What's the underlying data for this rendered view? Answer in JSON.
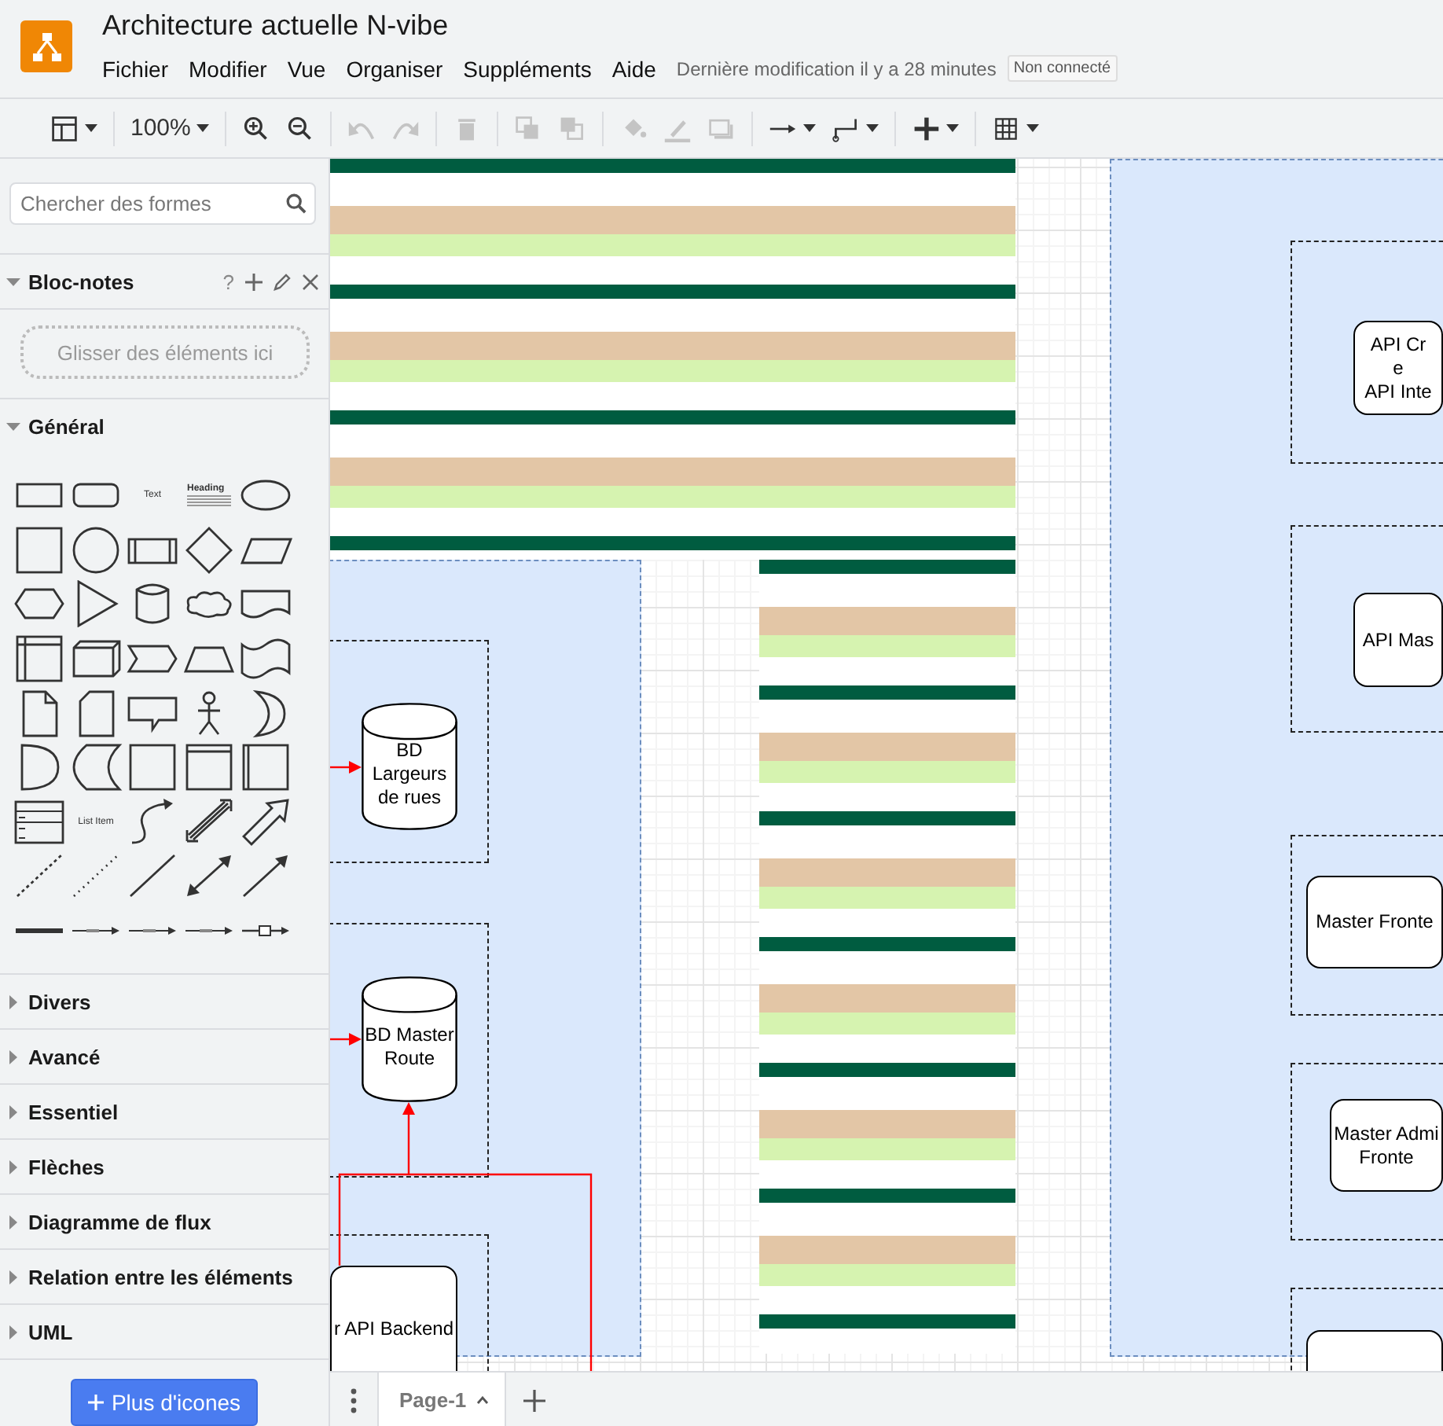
{
  "app": {
    "title": "Architecture actuelle N-vibe",
    "menu": [
      "Fichier",
      "Modifier",
      "Vue",
      "Organiser",
      "Suppléments",
      "Aide"
    ],
    "last_saved": "Dernière modification il y a 28 minutes",
    "status_badge": "Non connecté"
  },
  "toolbar": [
    [
      {
        "kind": "panel",
        "dropdown": true,
        "disabled": false
      }
    ],
    [
      {
        "kind": "zoom",
        "label": "100%",
        "dropdown": true,
        "disabled": false
      }
    ],
    [
      {
        "kind": "zoomin",
        "dropdown": false,
        "disabled": false
      },
      {
        "kind": "zoomout",
        "dropdown": false,
        "disabled": false
      }
    ],
    [
      {
        "kind": "undo",
        "dropdown": false,
        "disabled": true
      },
      {
        "kind": "redo",
        "dropdown": false,
        "disabled": true
      }
    ],
    [
      {
        "kind": "delete",
        "dropdown": false,
        "disabled": true
      }
    ],
    [
      {
        "kind": "tofront",
        "dropdown": false,
        "disabled": true
      },
      {
        "kind": "toback",
        "dropdown": false,
        "disabled": true
      }
    ],
    [
      {
        "kind": "fill",
        "dropdown": false,
        "disabled": true
      },
      {
        "kind": "linecolor",
        "dropdown": false,
        "disabled": true
      },
      {
        "kind": "shadow",
        "dropdown": false,
        "disabled": true
      }
    ],
    [
      {
        "kind": "connection",
        "dropdown": true,
        "disabled": false
      },
      {
        "kind": "waypoints",
        "dropdown": true,
        "disabled": false
      }
    ],
    [
      {
        "kind": "insert",
        "dropdown": true,
        "disabled": false
      }
    ],
    [
      {
        "kind": "table",
        "dropdown": true,
        "disabled": false
      }
    ]
  ],
  "sidebar": {
    "search": {
      "placeholder": "Chercher des formes"
    },
    "scratchpad": {
      "title": "Bloc-notes",
      "expanded": true,
      "help": "?",
      "drop_hint": "Glisser des éléments ici"
    },
    "general": {
      "title": "Général",
      "expanded": true,
      "shapes": [
        {
          "kind": "rect"
        },
        {
          "kind": "rounded"
        },
        {
          "kind": "text",
          "label": "Text"
        },
        {
          "kind": "heading",
          "label": "Heading"
        },
        {
          "kind": "ellipse"
        },
        {
          "kind": "square"
        },
        {
          "kind": "circle"
        },
        {
          "kind": "process"
        },
        {
          "kind": "diamond"
        },
        {
          "kind": "parallelogram"
        },
        {
          "kind": "hexagon"
        },
        {
          "kind": "triangle"
        },
        {
          "kind": "cylinder"
        },
        {
          "kind": "cloud"
        },
        {
          "kind": "document"
        },
        {
          "kind": "storage"
        },
        {
          "kind": "cube"
        },
        {
          "kind": "step"
        },
        {
          "kind": "trapezoid"
        },
        {
          "kind": "tape"
        },
        {
          "kind": "note"
        },
        {
          "kind": "card"
        },
        {
          "kind": "callout"
        },
        {
          "kind": "actor"
        },
        {
          "kind": "crescent"
        },
        {
          "kind": "halfround"
        },
        {
          "kind": "datastore"
        },
        {
          "kind": "square"
        },
        {
          "kind": "container"
        },
        {
          "kind": "swimlane"
        },
        {
          "kind": "list"
        },
        {
          "kind": "text",
          "label": "List Item"
        },
        {
          "kind": "curve"
        },
        {
          "kind": "doublearrow"
        },
        {
          "kind": "blockarrow"
        },
        {
          "kind": "dashed"
        },
        {
          "kind": "dotted"
        },
        {
          "kind": "line"
        },
        {
          "kind": "bidirectional"
        },
        {
          "kind": "directional"
        },
        {
          "kind": "thickline"
        },
        {
          "kind": "labeled"
        },
        {
          "kind": "labeled"
        },
        {
          "kind": "labeled"
        },
        {
          "kind": "boxlink"
        }
      ]
    },
    "sections": [
      {
        "title": "Divers",
        "expanded": false
      },
      {
        "title": "Avancé",
        "expanded": false
      },
      {
        "title": "Essentiel",
        "expanded": false
      },
      {
        "title": "Flèches",
        "expanded": false
      },
      {
        "title": "Diagramme de flux",
        "expanded": false
      },
      {
        "title": "Relation entre les éléments",
        "expanded": false
      },
      {
        "title": "UML",
        "expanded": false
      }
    ],
    "more_button": "Plus d'icones"
  },
  "canvas": {
    "nodes": [
      {
        "kind": "cylinder",
        "lines": [
          "BD",
          "Largeurs",
          "de rues"
        ]
      },
      {
        "kind": "cylinder",
        "lines": [
          "BD Master",
          "Route"
        ]
      },
      {
        "kind": "rounded",
        "lines": [
          "r API Backend"
        ]
      },
      {
        "kind": "rounded",
        "lines": [
          "API Cr",
          "e",
          "API Inte"
        ]
      },
      {
        "kind": "rounded",
        "lines": [
          "API Mas"
        ]
      },
      {
        "kind": "rounded",
        "lines": [
          "Master Fronte"
        ]
      },
      {
        "kind": "rounded",
        "lines": [
          "Master Admi",
          "Fronte"
        ]
      },
      {
        "kind": "rounded"
      }
    ]
  },
  "pages": {
    "tabs": [
      {
        "label": "Page-1",
        "selected": true
      }
    ]
  }
}
